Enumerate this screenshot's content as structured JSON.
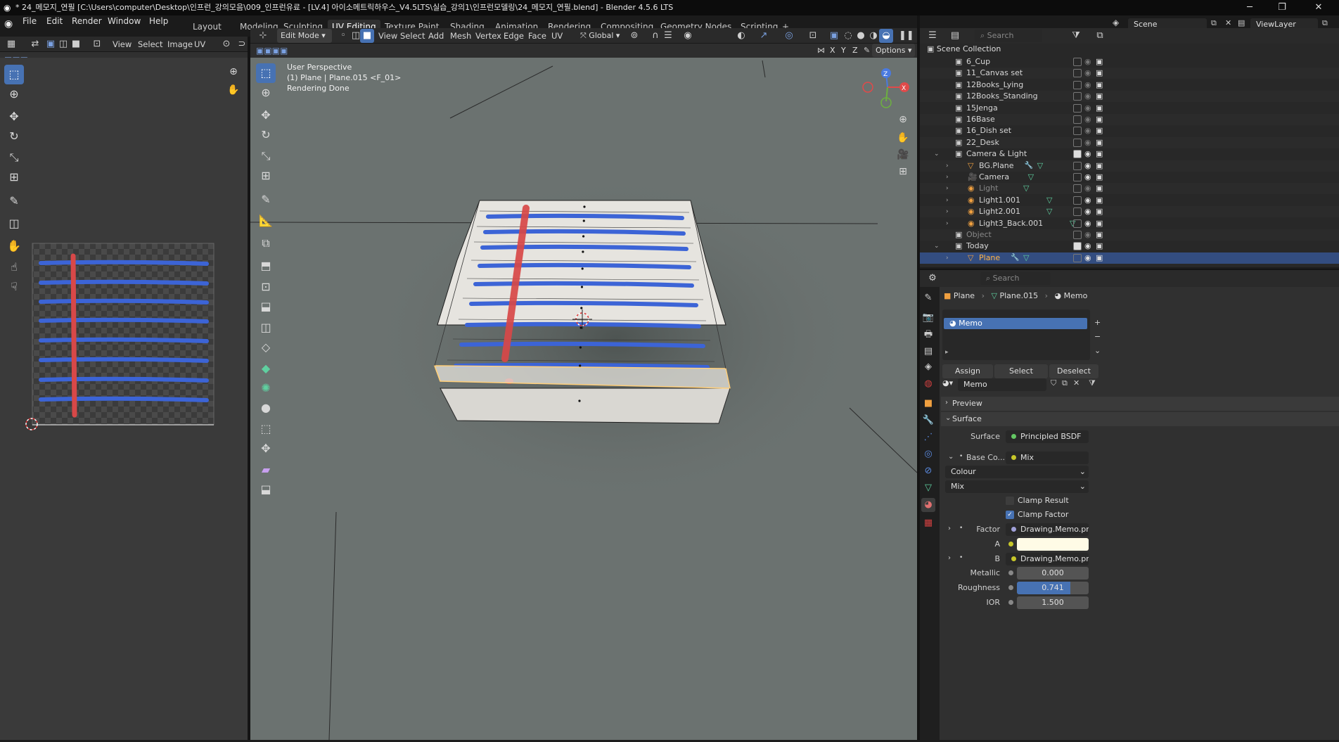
{
  "window": {
    "title": "* 24_메모지_연필 [C:\\Users\\computer\\Desktop\\인프런_강의모음\\009_인프런유료 - [LV.4] 아이소메트릭하우스_V4.5LTS\\실습_강의1\\인프런모델링\\24_메모지_연필.blend] - Blender 4.5.6 LTS"
  },
  "menu": [
    "File",
    "Edit",
    "Render",
    "Window",
    "Help"
  ],
  "workspaces": [
    "Layout",
    "Modeling",
    "Sculpting",
    "UV Editing",
    "Texture Paint",
    "Shading",
    "Animation",
    "Rendering",
    "Compositing",
    "Geometry Nodes",
    "Scripting",
    "+"
  ],
  "scene": {
    "name": "Scene",
    "view_layer": "ViewLayer"
  },
  "uv_header": {
    "menus": [
      "View",
      "Select",
      "Image",
      "UV"
    ]
  },
  "vp_header": {
    "mode": "Edit Mode",
    "menus": [
      "View",
      "Select",
      "Add",
      "Mesh",
      "Vertex",
      "Edge",
      "Face",
      "UV"
    ],
    "orientation": "Global",
    "options": "Options",
    "axes": [
      "X",
      "Y",
      "Z"
    ]
  },
  "viewport": {
    "line1": "User Perspective",
    "line2": "(1) Plane | Plane.015 <F_01>",
    "line3": "Rendering Done"
  },
  "outliner": {
    "search_placeholder": "Search",
    "root": "Scene Collection",
    "rows": [
      {
        "label": "6_Cup",
        "indent": 0,
        "kind": "collection"
      },
      {
        "label": "11_Canvas set",
        "indent": 0,
        "kind": "collection"
      },
      {
        "label": "12Books_Lying",
        "indent": 0,
        "kind": "collection"
      },
      {
        "label": "12Books_Standing",
        "indent": 0,
        "kind": "collection"
      },
      {
        "label": "15Jenga",
        "indent": 0,
        "kind": "collection"
      },
      {
        "label": "16Base",
        "indent": 0,
        "kind": "collection"
      },
      {
        "label": "16_Dish set",
        "indent": 0,
        "kind": "collection"
      },
      {
        "label": "22_Desk",
        "indent": 0,
        "kind": "collection"
      },
      {
        "label": "Camera & Light",
        "indent": 0,
        "kind": "collection-open"
      },
      {
        "label": "BG.Plane",
        "indent": 1,
        "kind": "mesh"
      },
      {
        "label": "Camera",
        "indent": 1,
        "kind": "camera"
      },
      {
        "label": "Light",
        "indent": 1,
        "kind": "light-off"
      },
      {
        "label": "Light1.001",
        "indent": 1,
        "kind": "light"
      },
      {
        "label": "Light2.001",
        "indent": 1,
        "kind": "light"
      },
      {
        "label": "Light3_Back.001",
        "indent": 1,
        "kind": "light"
      },
      {
        "label": "Object",
        "indent": 0,
        "kind": "collection"
      },
      {
        "label": "Today",
        "indent": 0,
        "kind": "collection-open"
      },
      {
        "label": "Plane",
        "indent": 1,
        "kind": "mesh-selected"
      }
    ]
  },
  "properties": {
    "search_placeholder": "Search",
    "breadcrumb": [
      "Plane",
      "Plane.015",
      "Memo"
    ],
    "slot": "Memo",
    "assign": "Assign",
    "select": "Select",
    "deselect": "Deselect",
    "material": "Memo",
    "preview": "Preview",
    "surface_panel": "Surface",
    "surface_label": "Surface",
    "surface_value": "Principled BSDF",
    "basecolor_label": "Base Co...",
    "basecolor_value": "Mix",
    "colour": "Colour",
    "mix": "Mix",
    "clamp_result": "Clamp Result",
    "clamp_factor": "Clamp Factor",
    "factor_label": "Factor",
    "factor_value": "Drawing.Memo.png",
    "a_label": "A",
    "b_label": "B",
    "b_value": "Drawing.Memo.png",
    "metallic_label": "Metallic",
    "metallic_value": "0.000",
    "roughness_label": "Roughness",
    "roughness_value": "0.741",
    "roughness_fraction": 0.741,
    "ior_label": "IOR",
    "ior_value": "1.500"
  },
  "colors": {
    "accent": "#4772b3",
    "memo_line": "#3c64d6",
    "pencil": "#d84848",
    "a_color": "#fffbe6"
  }
}
